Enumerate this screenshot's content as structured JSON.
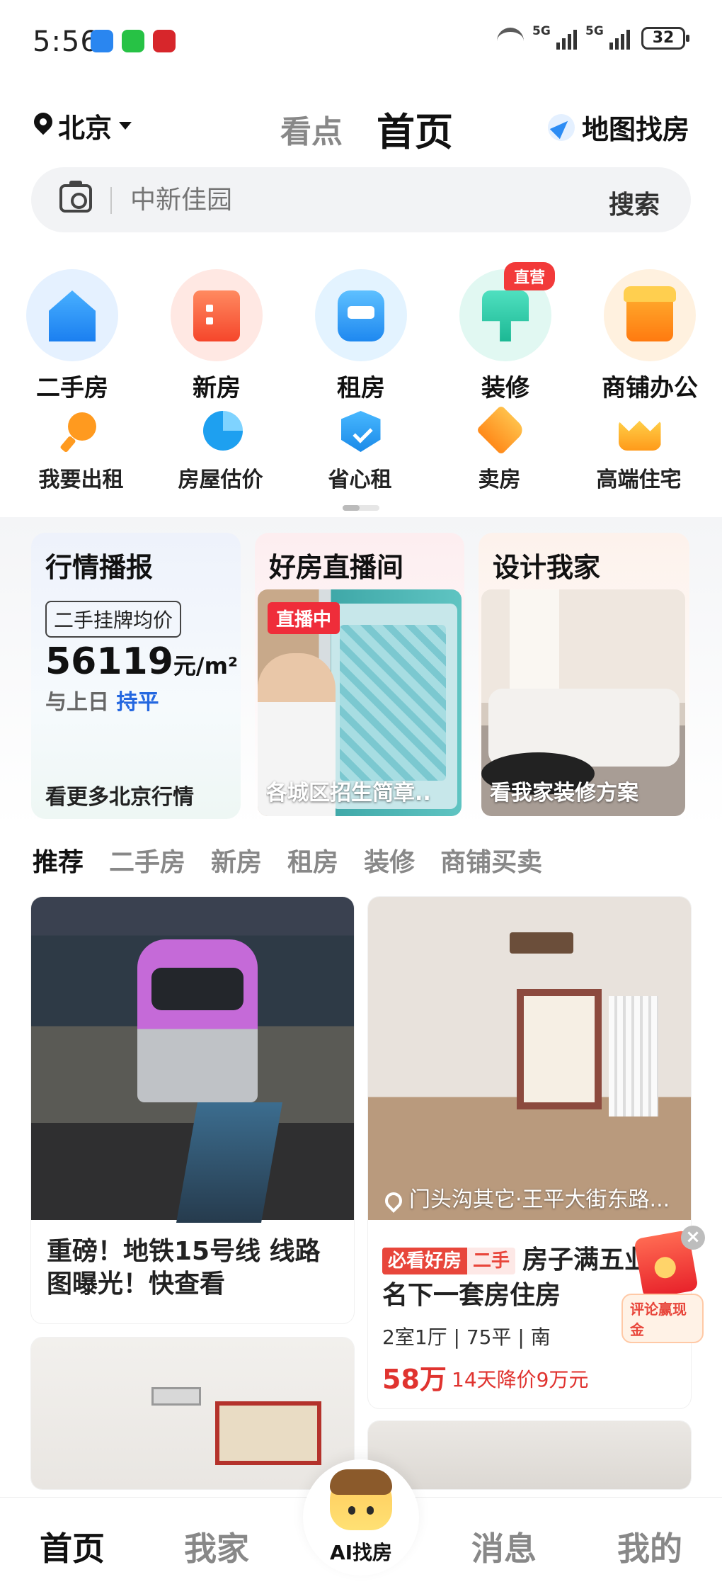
{
  "status_bar": {
    "time": "5:56",
    "signal1": "5G",
    "signal2": "5G",
    "battery": "32"
  },
  "header": {
    "city": "北京",
    "tab_kandian": "看点",
    "tab_home": "首页",
    "map_search": "地图找房"
  },
  "search": {
    "placeholder": "中新佳园",
    "button": "搜索"
  },
  "quick_primary": [
    {
      "label": "二手房",
      "icon": "house-icon"
    },
    {
      "label": "新房",
      "icon": "building-icon"
    },
    {
      "label": "租房",
      "icon": "sofa-icon"
    },
    {
      "label": "装修",
      "icon": "paint-roller-icon",
      "badge": "直营"
    },
    {
      "label": "商铺办公",
      "icon": "shop-icon"
    }
  ],
  "quick_secondary": [
    {
      "label": "我要出租",
      "icon": "key-icon"
    },
    {
      "label": "房屋估价",
      "icon": "pie-chart-icon"
    },
    {
      "label": "省心租",
      "icon": "shield-check-icon"
    },
    {
      "label": "卖房",
      "icon": "price-tag-icon"
    },
    {
      "label": "高端住宅",
      "icon": "crown-icon"
    }
  ],
  "market": {
    "title": "行情播报",
    "chip": "二手挂牌均价",
    "price": "56119",
    "unit": "元/m²",
    "compare_prefix": "与上日",
    "compare_value": "持平",
    "more": "看更多北京行情"
  },
  "live": {
    "title": "好房直播间",
    "badge": "直播中",
    "caption": "各城区招生简章.."
  },
  "design": {
    "title": "设计我家",
    "caption": "看我家装修方案"
  },
  "category_tabs": [
    "推荐",
    "二手房",
    "新房",
    "租房",
    "装修",
    "商铺买卖"
  ],
  "feed": {
    "news_title": "重磅！地铁15号线 线路图曝光！快查看",
    "listing_location": "门头沟其它·王平大街东路...",
    "listing_tag1": "必看好房",
    "listing_tag2": "二手",
    "listing_title": "房子满五业主名下一套房住房",
    "listing_spec": "2室1厅 | 75平 | 南",
    "listing_price": "58万",
    "listing_cut": "14天降价9万元",
    "promo_label": "评论赢现金",
    "promo_close": "×"
  },
  "bottom_nav": {
    "home": "首页",
    "myhome": "我家",
    "ai": "AI找房",
    "messages": "消息",
    "mine": "我的"
  },
  "colors": {
    "accent_red": "#e8463b",
    "accent_blue": "#2467e0",
    "live_red": "#ef2d3a"
  }
}
